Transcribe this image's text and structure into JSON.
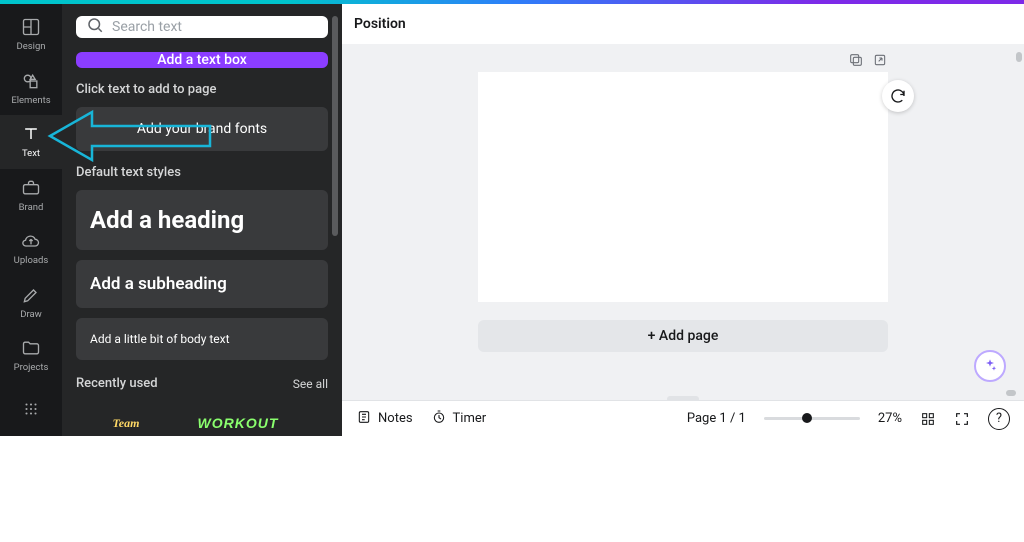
{
  "navrail": {
    "items": [
      {
        "label": "Design"
      },
      {
        "label": "Elements"
      },
      {
        "label": "Text"
      },
      {
        "label": "Brand"
      },
      {
        "label": "Uploads"
      },
      {
        "label": "Draw"
      },
      {
        "label": "Projects"
      }
    ]
  },
  "search": {
    "placeholder": "Search text"
  },
  "sidepanel": {
    "add_text_box": "Add a text box",
    "click_label": "Click text to add to page",
    "brand_fonts": "Add your brand fonts",
    "default_styles": "Default text styles",
    "heading": "Add a heading",
    "subheading": "Add a subheading",
    "body": "Add a little bit of body text",
    "recent": "Recently used",
    "see_all": "See all",
    "thumbs": {
      "t1": "Team",
      "t2": "WORKOUT"
    }
  },
  "canvas": {
    "toolbar_label": "Position",
    "add_page": "+ Add page"
  },
  "bottombar": {
    "notes": "Notes",
    "timer": "Timer",
    "page_info": "Page 1 / 1",
    "zoom": "27%"
  },
  "colors": {
    "accent": "#8b3dff"
  }
}
